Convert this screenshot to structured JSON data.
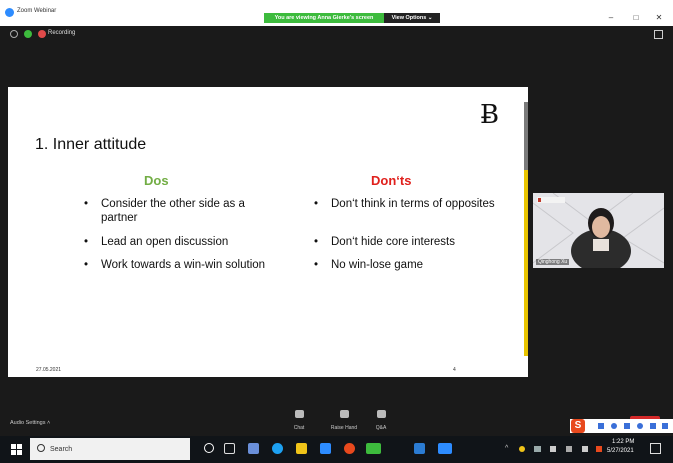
{
  "window": {
    "title": "Zoom Webinar",
    "viewing_banner": "You are viewing Anna Gierke's screen",
    "view_options": "View Options ⌄",
    "minimize": "–",
    "maximize": "□",
    "close": "✕"
  },
  "status": {
    "recording_label": "Recording"
  },
  "slide": {
    "logo_glyph": "Ƀ",
    "title": "1. Inner attitude",
    "dos": {
      "heading": "Dos",
      "items": [
        "Consider the other side as a partner",
        "Lead an open discussion",
        "Work towards a win-win solution"
      ]
    },
    "donts": {
      "heading": "Don‘ts",
      "items": [
        "Don‘t think in terms of opposites",
        "Don‘t hide core interests",
        "No win-lose game"
      ]
    },
    "bullet": "•",
    "date": "27.05.2021",
    "page": "4"
  },
  "video": {
    "participant_name": "Qinghong Xu"
  },
  "toolbar": {
    "audio_settings": "Audio Settings  ˄",
    "chat": "Chat",
    "raise_hand": "Raise Hand",
    "qa": "Q&A"
  },
  "taskbar": {
    "search_placeholder": "Search",
    "time": "1:22 PM",
    "date": "5/27/2021",
    "ime_logo": "S"
  },
  "colors": {
    "dos": "#72ad44",
    "donts": "#e0201c",
    "banner": "#3dbb3d",
    "scroll_active": "#e8c400"
  }
}
